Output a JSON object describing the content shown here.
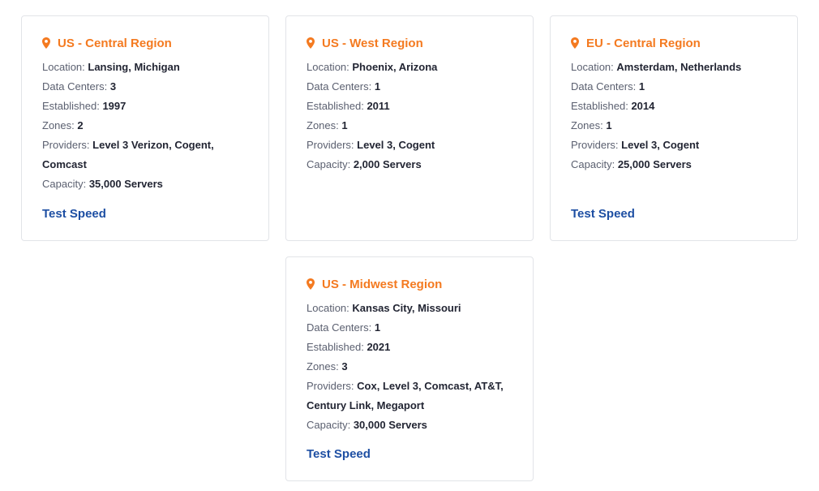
{
  "colors": {
    "accent": "#f47a20",
    "link": "#1e4fa3",
    "label": "#5b6070",
    "value": "#222533",
    "border": "#e2e4e8"
  },
  "icons": {
    "region": "location-pin-icon"
  },
  "cards": [
    {
      "title": "US - Central Region",
      "location_label": "Location:",
      "location": "Lansing, Michigan",
      "data_centers_label": "Data Centers:",
      "data_centers": "3",
      "established_label": "Established:",
      "established": "1997",
      "zones_label": "Zones:",
      "zones": "2",
      "providers_label": "Providers:",
      "providers": "Level 3 Verizon, Cogent, Comcast",
      "capacity_label": "Capacity:",
      "capacity": "35,000 Servers",
      "link_label": "Test Speed"
    },
    {
      "title": "US - West Region",
      "location_label": "Location:",
      "location": "Phoenix, Arizona",
      "data_centers_label": "Data Centers:",
      "data_centers": "1",
      "established_label": "Established:",
      "established": "2011",
      "zones_label": "Zones:",
      "zones": "1",
      "providers_label": "Providers:",
      "providers": "Level 3, Cogent",
      "capacity_label": "Capacity:",
      "capacity": "2,000 Servers"
    },
    {
      "title": "EU - Central Region",
      "location_label": "Location:",
      "location": "Amsterdam, Netherlands",
      "data_centers_label": "Data Centers:",
      "data_centers": "1",
      "established_label": "Established:",
      "established": "2014",
      "zones_label": "Zones:",
      "zones": "1",
      "providers_label": "Providers:",
      "providers": "Level 3, Cogent",
      "capacity_label": "Capacity:",
      "capacity": "25,000 Servers",
      "link_label": "Test Speed"
    },
    {
      "title": "US - Midwest Region",
      "location_label": "Location:",
      "location": "Kansas City, Missouri",
      "data_centers_label": "Data Centers:",
      "data_centers": "1",
      "established_label": "Established:",
      "established": "2021",
      "zones_label": "Zones:",
      "zones": "3",
      "providers_label": "Providers:",
      "providers": "Cox, Level 3, Comcast, AT&T, Century Link, Megaport",
      "capacity_label": "Capacity:",
      "capacity": "30,000 Servers",
      "link_label": "Test Speed"
    }
  ]
}
